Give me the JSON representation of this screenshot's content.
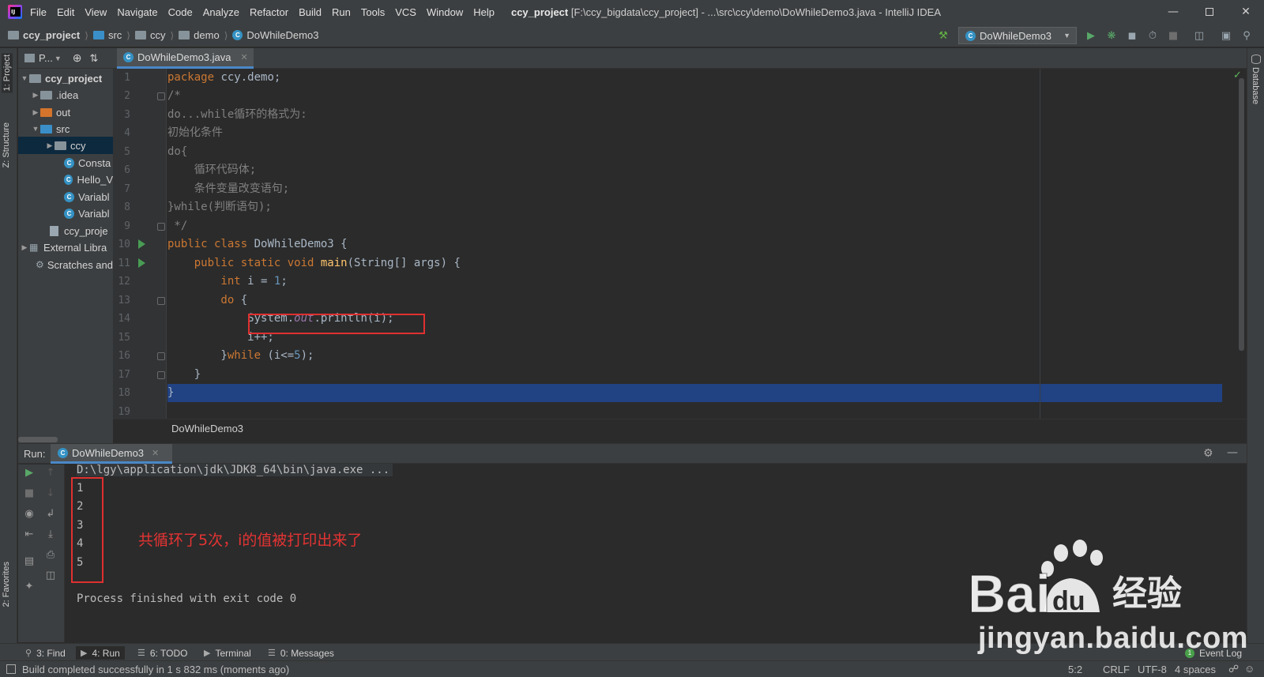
{
  "menu": [
    "File",
    "Edit",
    "View",
    "Navigate",
    "Code",
    "Analyze",
    "Refactor",
    "Build",
    "Run",
    "Tools",
    "VCS",
    "Window",
    "Help"
  ],
  "window_title": {
    "project": "ccy_project",
    "rest": "[F:\\ccy_bigdata\\ccy_project] - ...\\src\\ccy\\demo\\DoWhileDemo3.java - IntelliJ IDEA"
  },
  "breadcrumbs": [
    "ccy_project",
    "src",
    "ccy",
    "demo",
    "DoWhileDemo3"
  ],
  "run_config": "DoWhileDemo3",
  "left_strip": {
    "project_tab": "1: Project",
    "structure_tab": "Z: Structure",
    "favorites_tab": "2: Favorites"
  },
  "right_strip": {
    "database_tab": "Database"
  },
  "project_pane": {
    "header": "P...",
    "tree": [
      {
        "label": "ccy_project",
        "kind": "module"
      },
      {
        "label": ".idea",
        "kind": "folder"
      },
      {
        "label": "out",
        "kind": "folder-orange"
      },
      {
        "label": "src",
        "kind": "folder-blue"
      },
      {
        "label": "ccy",
        "kind": "package"
      },
      {
        "label": "Consta",
        "kind": "class"
      },
      {
        "label": "Hello_V",
        "kind": "class"
      },
      {
        "label": "Variabl",
        "kind": "class"
      },
      {
        "label": "Variabl",
        "kind": "class"
      },
      {
        "label": "ccy_proje",
        "kind": "file"
      },
      {
        "label": "External Libra",
        "kind": "libs"
      },
      {
        "label": "Scratches and",
        "kind": "scratch"
      }
    ]
  },
  "editor": {
    "tab": "DoWhileDemo3.java",
    "line_numbers": [
      "1",
      "2",
      "3",
      "4",
      "5",
      "6",
      "7",
      "8",
      "9",
      "10",
      "11",
      "12",
      "13",
      "14",
      "15",
      "16",
      "17",
      "18",
      "19"
    ],
    "breadcrumb": "DoWhileDemo3",
    "code": {
      "l1_kw": "package",
      "l1_rest": " ccy.demo;",
      "l2": "/*",
      "l3": "do...while循环的格式为:",
      "l4": "初始化条件",
      "l5": "do{",
      "l6": "    循环代码体;",
      "l7": "    条件变量改变语句;",
      "l8": "}while(判断语句);",
      "l9": " */",
      "l10_kw": "public class",
      "l10_rest": " DoWhileDemo3 {",
      "l11_kw": "    public static void",
      "l11_fn": " main",
      "l11_rest": "(String[] args) {",
      "l12_kw": "        int",
      "l12_mid": " i = ",
      "l12_num": "1",
      "l12_end": ";",
      "l13_kw": "        do",
      "l13_rest": " {",
      "l14_a": "            System.",
      "l14_fld": "out",
      "l14_b": ".println(i);",
      "l15": "            i++;",
      "l16_a": "        }",
      "l16_kw": "while",
      "l16_b": " (i<=",
      "l16_num": "5",
      "l16_c": ");",
      "l17": "    }",
      "l18": "}"
    }
  },
  "run_window": {
    "label": "Run:",
    "tab": "DoWhileDemo3",
    "command": "D:\\lgy\\application\\jdk\\JDK8_64\\bin\\java.exe ...",
    "output": [
      "1",
      "2",
      "3",
      "4",
      "5"
    ],
    "finished": "Process finished with exit code 0",
    "annotation": "共循环了5次，i的值被打印出来了"
  },
  "bottom_tabs": [
    {
      "label": "3: Find",
      "icon": "search-icon"
    },
    {
      "label": "4: Run",
      "icon": "run-icon"
    },
    {
      "label": "6: TODO",
      "icon": "list-icon"
    },
    {
      "label": "Terminal",
      "icon": "terminal-icon"
    },
    {
      "label": "0: Messages",
      "icon": "messages-icon"
    }
  ],
  "event_log": "Event Log",
  "status": {
    "message": "Build completed successfully in 1 s 832 ms (moments ago)",
    "position": "5:2",
    "line_sep": "CRLF",
    "encoding": "UTF-8",
    "indent": "4 spaces"
  },
  "watermark": {
    "brand": "Bai",
    "brand2": "du",
    "cn": "经验",
    "url": "jingyan.baidu.com"
  }
}
